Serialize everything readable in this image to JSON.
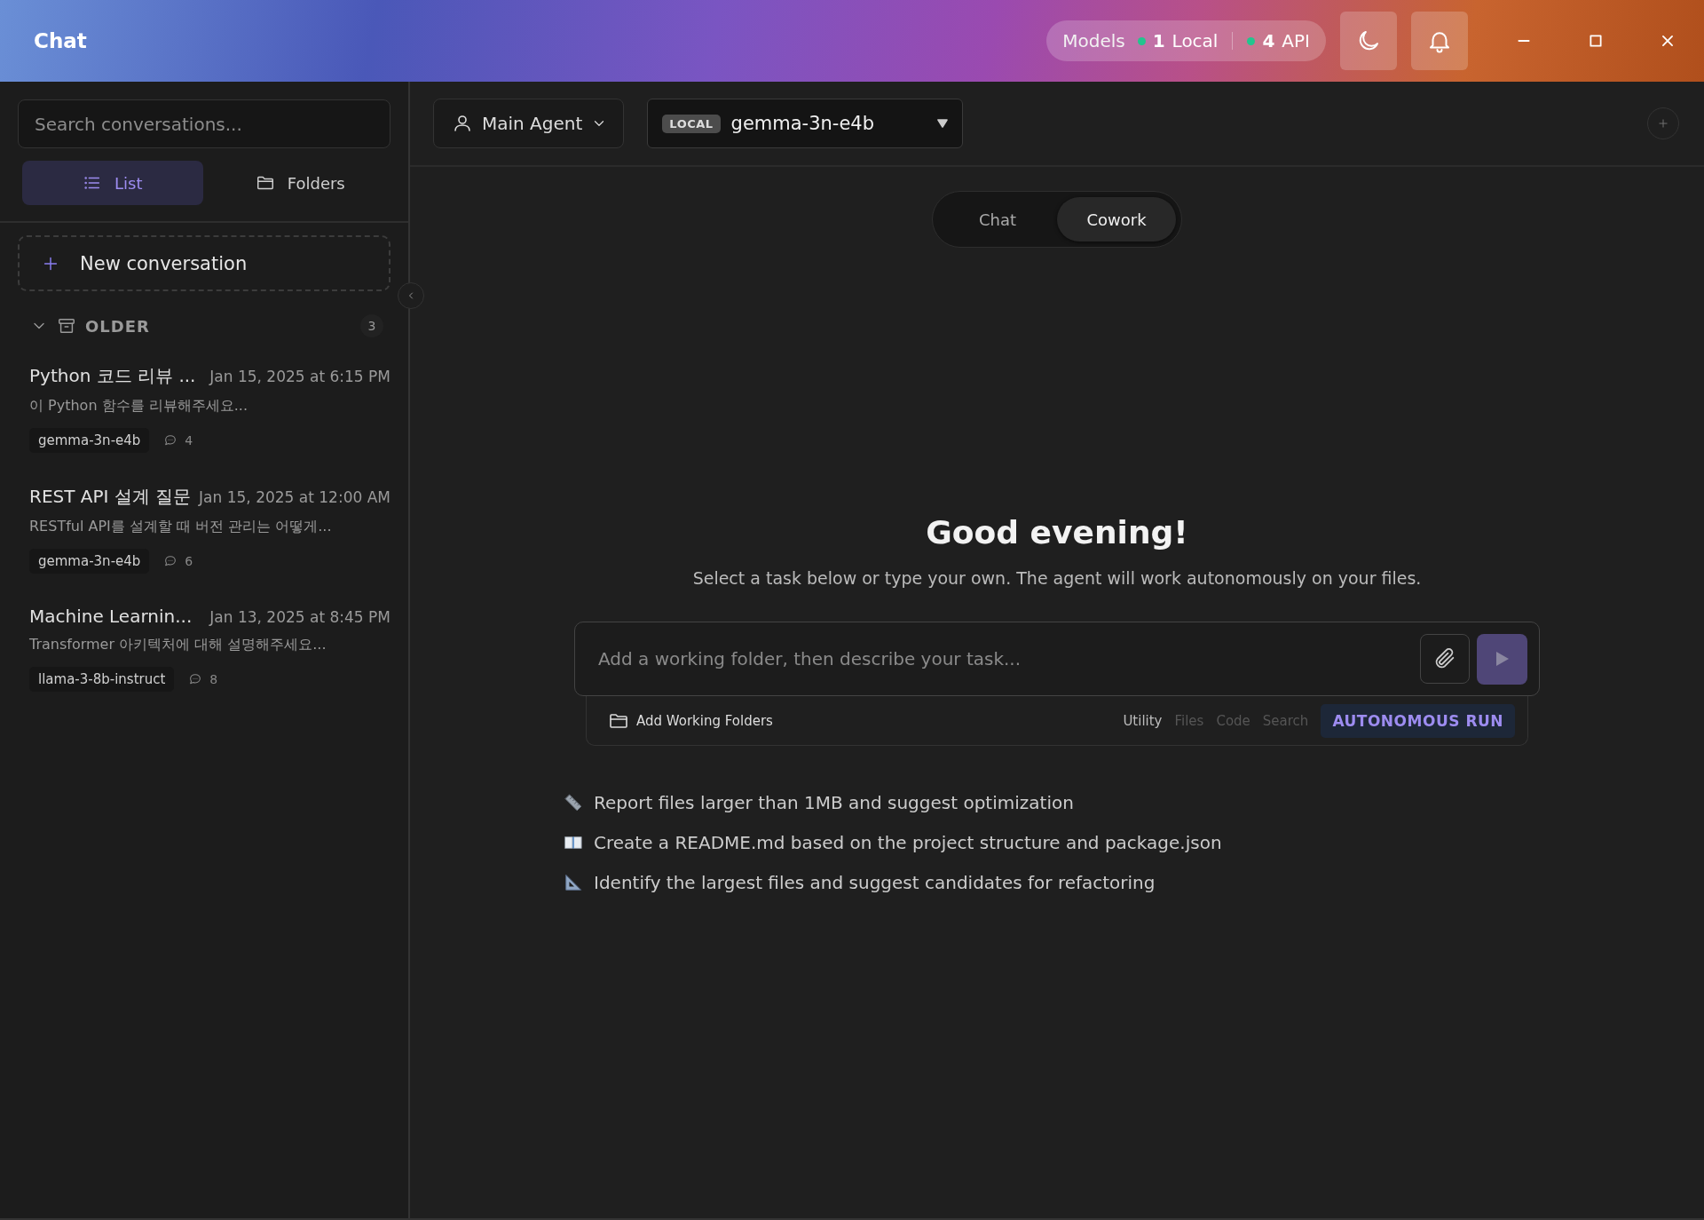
{
  "window": {
    "title": "Chat"
  },
  "models_status": {
    "label": "Models",
    "groups": [
      {
        "count": "1",
        "label": "Local",
        "color": "#22c58e"
      },
      {
        "count": "4",
        "label": "API",
        "color": "#22c58e"
      }
    ]
  },
  "sidebar": {
    "search": {
      "placeholder": "Search conversations..."
    },
    "view_tabs": [
      {
        "kind": "list",
        "label": "List",
        "selected": true
      },
      {
        "kind": "folder",
        "label": "Folders",
        "selected": false
      }
    ],
    "new_conversation": "New conversation",
    "group": {
      "label": "OLDER",
      "count": "3",
      "expanded": true
    },
    "conversations": [
      {
        "title": "Python 코드 리뷰 ...",
        "date": "Jan 15, 2025 at 6:15 PM",
        "preview": "이 Python 함수를 리뷰해주세요...",
        "model": "gemma-3n-e4b",
        "messages": "4"
      },
      {
        "title": "REST API 설계 질문",
        "date": "Jan 15, 2025 at 12:00 AM",
        "preview": "RESTful API를 설계할 때 버전 관리는 어떻게...",
        "model": "gemma-3n-e4b",
        "messages": "6"
      },
      {
        "title": "Machine Learnin...",
        "date": "Jan 13, 2025 at 8:45 PM",
        "preview": "Transformer 아키텍처에 대해 설명해주세요...",
        "model": "llama-3-8b-instruct",
        "messages": "8"
      }
    ]
  },
  "main": {
    "agent_selector": {
      "label": "Main Agent"
    },
    "model_selector": {
      "badge": "LOCAL",
      "value": "gemma-3n-e4b"
    },
    "mode_tabs": [
      {
        "label": "Chat",
        "selected": false
      },
      {
        "label": "Cowork",
        "selected": true
      }
    ],
    "greeting": "Good evening!",
    "subtitle": "Select a task below or type your own. The agent will work autonomously on your files.",
    "task_input": {
      "placeholder": "Add a working folder, then describe your task..."
    },
    "send_button": {
      "disabled": true
    },
    "add_folders": "Add Working Folders",
    "capabilities": [
      {
        "label": "Utility",
        "active": true
      },
      {
        "label": "Files",
        "active": false
      },
      {
        "label": "Code",
        "active": false
      },
      {
        "label": "Search",
        "active": false
      }
    ],
    "autonomous_run": "AUTONOMOUS RUN",
    "suggestions": [
      {
        "kind": "ruler",
        "text": "Report files larger than 1MB and suggest optimization"
      },
      {
        "kind": "book",
        "text": "Create a README.md based on the project structure and package.json"
      },
      {
        "kind": "set-square",
        "text": "Identify the largest files and suggest candidates for refactoring"
      }
    ]
  }
}
